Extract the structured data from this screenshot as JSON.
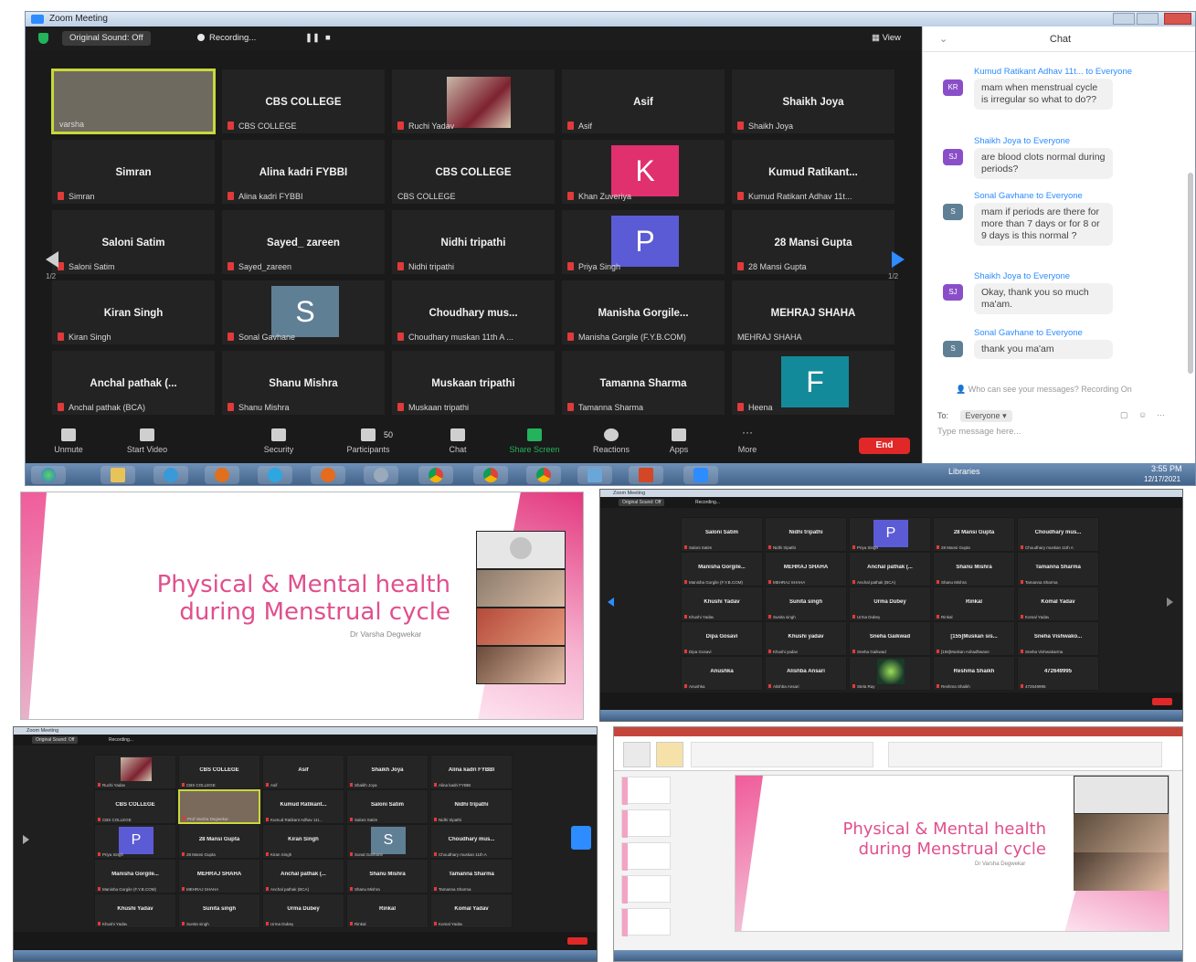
{
  "main": {
    "window_title": "Zoom Meeting",
    "topbar": {
      "sound_label": "Original Sound: Off",
      "recording_label": "Recording...",
      "view_label": "View"
    },
    "tiles": [
      {
        "name": "",
        "label": "varsha",
        "type": "video"
      },
      {
        "name": "CBS COLLEGE",
        "label": "CBS COLLEGE"
      },
      {
        "name": "",
        "label": "Ruchi Yadav",
        "type": "photo"
      },
      {
        "name": "Asif",
        "label": "Asif"
      },
      {
        "name": "Shaikh Joya",
        "label": "Shaikh Joya"
      },
      {
        "name": "Simran",
        "label": "Simran"
      },
      {
        "name": "Alina kadri FYBBI",
        "label": "Alina kadri FYBBI"
      },
      {
        "name": "CBS COLLEGE",
        "label": "CBS COLLEGE"
      },
      {
        "name": "",
        "label": "Khan Zuveriya",
        "letter": "K",
        "color": "#e0306e"
      },
      {
        "name": "Kumud  Ratikant...",
        "label": "Kumud Ratikant Adhav 11t..."
      },
      {
        "name": "Saloni Satim",
        "label": "Saloni Satim"
      },
      {
        "name": "Sayed_ zareen",
        "label": "Sayed_zareen"
      },
      {
        "name": "Nidhi tripathi",
        "label": "Nidhi tripathi"
      },
      {
        "name": "",
        "label": "Priya Singh",
        "letter": "P",
        "color": "#5b5bd6"
      },
      {
        "name": "28 Mansi Gupta",
        "label": "28 Mansi Gupta"
      },
      {
        "name": "Kiran Singh",
        "label": "Kiran Singh"
      },
      {
        "name": "",
        "label": "Sonal Gavhane",
        "letter": "S",
        "color": "#5f7f95"
      },
      {
        "name": "Choudhary  mus...",
        "label": "Choudhary muskan 11th A ..."
      },
      {
        "name": "Manisha  Gorgile...",
        "label": "Manisha Gorgile (F.Y.B.COM)"
      },
      {
        "name": "MEHRAJ SHAHA",
        "label": "MEHRAJ SHAHA"
      },
      {
        "name": "Anchal pathak (...",
        "label": "Anchal pathak (BCA)"
      },
      {
        "name": "Shanu Mishra",
        "label": "Shanu Mishra"
      },
      {
        "name": "Muskaan tripathi",
        "label": "Muskaan tripathi"
      },
      {
        "name": "Tamanna Sharma",
        "label": "Tamanna Sharma"
      },
      {
        "name": "",
        "label": "Heena",
        "letter": "F",
        "color": "#138a9a"
      }
    ],
    "page_indicator": "1/2",
    "toolbar": {
      "unmute": "Unmute",
      "start_video": "Start Video",
      "security": "Security",
      "participants": "Participants",
      "participants_count": "50",
      "chat": "Chat",
      "share_screen": "Share Screen",
      "reactions": "Reactions",
      "apps": "Apps",
      "more": "More",
      "end": "End"
    },
    "chat": {
      "title": "Chat",
      "messages": [
        {
          "from": "Kumud Ratikant Adhav 11t... to Everyone",
          "initials": "KR",
          "color": "#8a4fc8",
          "text": "mam when menstrual cycle is irregular so what to do??"
        },
        {
          "from": "Shaikh Joya to Everyone",
          "initials": "SJ",
          "color": "#8a4fc8",
          "text": "are blood clots normal during periods?"
        },
        {
          "from": "Sonal Gavhane to Everyone",
          "initials": "S",
          "color": "#5f7f95",
          "text": "mam if periods are there for more than 7 days or for 8 or 9 days is this normal ?"
        },
        {
          "from": "Shaikh Joya to Everyone",
          "initials": "SJ",
          "color": "#8a4fc8",
          "text": "Okay, thank you so much ma'am."
        },
        {
          "from": "Sonal Gavhane to Everyone",
          "initials": "S",
          "color": "#5f7f95",
          "text": "thank you ma'am"
        }
      ],
      "note": "Who can see your messages? Recording On",
      "to_label": "To:",
      "to_value": "Everyone",
      "placeholder": "Type message here..."
    },
    "taskbar": {
      "libraries": "Libraries",
      "time": "3:55 PM",
      "date": "12/17/2021"
    }
  },
  "slide": {
    "title_line1": "Physical & Mental health",
    "title_line2": "during Menstrual cycle",
    "author": "Dr Varsha Degwekar"
  },
  "small_right": {
    "tiles": [
      {
        "name": "Saloni Satim",
        "label": "Saloni Satim"
      },
      {
        "name": "Nidhi tripathi",
        "label": "Nidhi tripathi"
      },
      {
        "name": "",
        "label": "Priya Singh",
        "letter": "P",
        "color": "#5b5bd6"
      },
      {
        "name": "28 Mansi Gupta",
        "label": "28 Mansi Gupta"
      },
      {
        "name": "Choudhary  mus...",
        "label": "Choudhary muskan 11th A"
      },
      {
        "name": "Manisha  Gorgile...",
        "label": "Manisha Gorgile (F.Y.B.COM)"
      },
      {
        "name": "MEHRAJ SHAHA",
        "label": "MEHRAJ SHAHA"
      },
      {
        "name": "Anchal pathak (...",
        "label": "Anchal pathak (BCA)"
      },
      {
        "name": "Shanu Mishra",
        "label": "Shanu Mishra"
      },
      {
        "name": "Tamanna Sharma",
        "label": "Tamanna Sharma"
      },
      {
        "name": "Khushi Yadav",
        "label": "Khushi Yadav"
      },
      {
        "name": "Sunita singh",
        "label": "Sunita singh"
      },
      {
        "name": "Urma Dubey",
        "label": "Urma Dubey"
      },
      {
        "name": "Rinkal",
        "label": "Rinkal"
      },
      {
        "name": "Komal Yadav",
        "label": "Komal Yadav"
      },
      {
        "name": "Dipa Gosavi",
        "label": "Dipa Gosavi"
      },
      {
        "name": "Khushi yadav",
        "label": "Khushi yadav"
      },
      {
        "name": "Sneha Gaikwad",
        "label": "Sneha Gaikwad"
      },
      {
        "name": "[155]Muskan sis...",
        "label": "[155]Muskan Ashadhwane"
      },
      {
        "name": "Sneha Vishwako...",
        "label": "Sneha Vishwakarma"
      },
      {
        "name": "Anushka",
        "label": "Anushka"
      },
      {
        "name": "Alishba Ansari",
        "label": "Alishba Ansari"
      },
      {
        "name": "",
        "label": "Stela Ray",
        "type": "butterfly"
      },
      {
        "name": "Reshma Shaikh",
        "label": "Reshma Shaikh"
      },
      {
        "name": "472649995",
        "label": "472649995"
      }
    ]
  },
  "small_left": {
    "tiles": [
      {
        "name": "",
        "label": "Ruchi Yadav",
        "type": "photo"
      },
      {
        "name": "CBS COLLEGE",
        "label": "CBS COLLEGE"
      },
      {
        "name": "Asif",
        "label": "Asif"
      },
      {
        "name": "Shaikh Joya",
        "label": "Shaikh Joya"
      },
      {
        "name": "Alina kadri FYBBI",
        "label": "Alina kadri FYBBI"
      },
      {
        "name": "CBS COLLEGE",
        "label": "CBS COLLEGE"
      },
      {
        "name": "",
        "label": "Prof Varsha Degwekar",
        "type": "video"
      },
      {
        "name": "Kumud  Ratikant...",
        "label": "Kumud Ratikant Adhav 11t..."
      },
      {
        "name": "Saloni Satim",
        "label": "Saloni Satim"
      },
      {
        "name": "Nidhi tripathi",
        "label": "Nidhi tripathi"
      },
      {
        "name": "",
        "label": "Priya Singh",
        "letter": "P",
        "color": "#5b5bd6"
      },
      {
        "name": "28 Mansi Gupta",
        "label": "28 Mansi Gupta"
      },
      {
        "name": "Kiran Singh",
        "label": "Kiran Singh"
      },
      {
        "name": "",
        "label": "Sonal Gavhane",
        "letter": "S",
        "color": "#5f7f95"
      },
      {
        "name": "Choudhary  mus...",
        "label": "Choudhary muskan 11th A"
      },
      {
        "name": "Manisha  Gorgile...",
        "label": "Manisha Gorgile (F.Y.B.COM)"
      },
      {
        "name": "MEHRAJ SHAHA",
        "label": "MEHRAJ SHAHA"
      },
      {
        "name": "Anchal pathak (...",
        "label": "Anchal pathak (BCA)"
      },
      {
        "name": "Shanu Mishra",
        "label": "Shanu Mishra"
      },
      {
        "name": "Tamanna Sharma",
        "label": "Tamanna Sharma"
      },
      {
        "name": "Khushi Yadav",
        "label": "Khushi Yadav"
      },
      {
        "name": "Sunita singh",
        "label": "Sunita singh"
      },
      {
        "name": "Urma Dubey",
        "label": "Urma Dubey"
      },
      {
        "name": "Rinkal",
        "label": "Rinkal"
      },
      {
        "name": "Komal Yadav",
        "label": "Komal Yadav"
      }
    ]
  },
  "ppt": {
    "title_line1": "Physical & Mental health",
    "title_line2": "during Menstrual cycle",
    "author": "Dr Varsha Degwekar"
  }
}
